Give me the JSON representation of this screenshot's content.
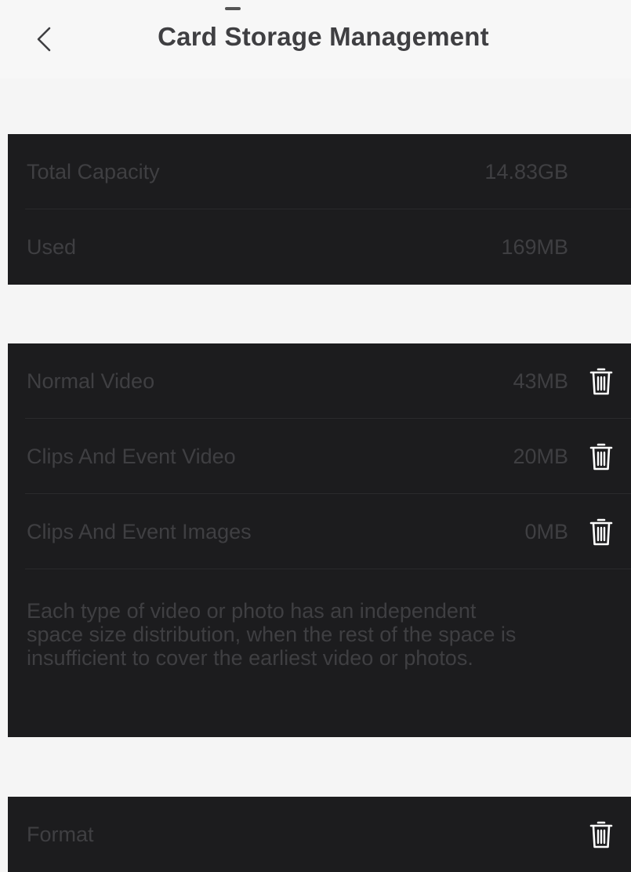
{
  "header": {
    "title": "Card Storage Management"
  },
  "capacity": {
    "total_label": "Total Capacity",
    "total_value": "14.83GB",
    "used_label": "Used",
    "used_value": "169MB"
  },
  "categories": {
    "items": [
      {
        "label": "Normal Video",
        "value": "43MB"
      },
      {
        "label": "Clips And Event Video",
        "value": "20MB"
      },
      {
        "label": "Clips And Event Images",
        "value": "0MB"
      }
    ],
    "note": "Each type of video or photo has an independent space size distribution, when the rest of the space is insufficient to cover the earliest video or photos."
  },
  "format": {
    "label": "Format"
  },
  "icons": {
    "back": "chevron-left-icon",
    "delete": "trash-icon"
  },
  "colors": {
    "panel": "#1c1c1e",
    "background": "#f5f5f5",
    "title": "#3f3f42",
    "icon": "#ffffff"
  }
}
